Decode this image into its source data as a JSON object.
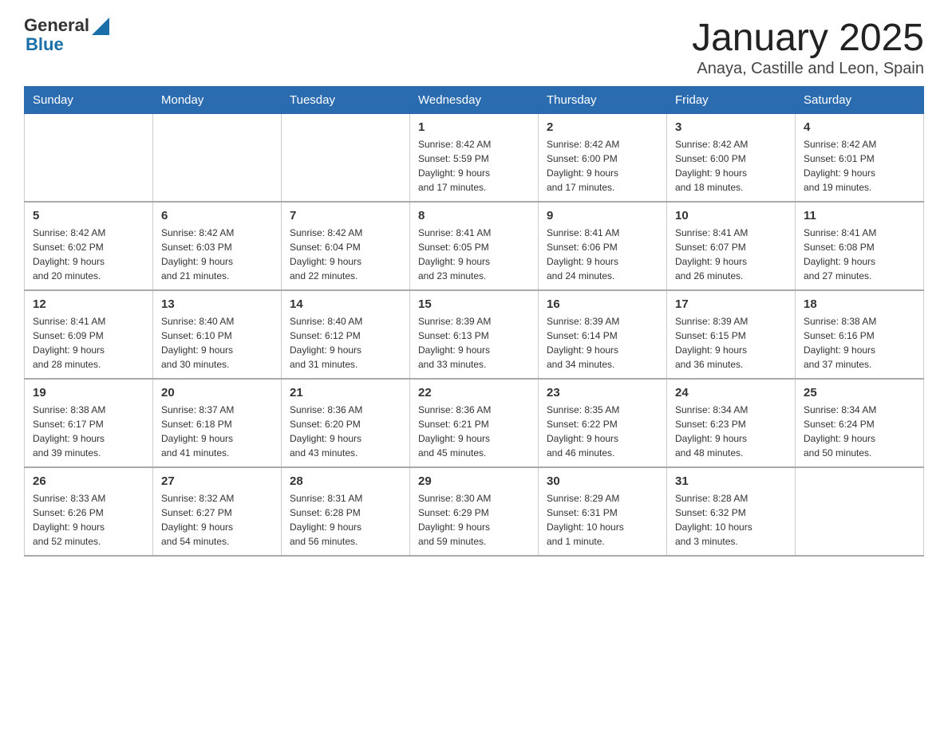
{
  "logo": {
    "text_general": "General",
    "text_blue": "Blue"
  },
  "header": {
    "title": "January 2025",
    "subtitle": "Anaya, Castille and Leon, Spain"
  },
  "weekdays": [
    "Sunday",
    "Monday",
    "Tuesday",
    "Wednesday",
    "Thursday",
    "Friday",
    "Saturday"
  ],
  "weeks": [
    [
      {
        "day": "",
        "info": ""
      },
      {
        "day": "",
        "info": ""
      },
      {
        "day": "",
        "info": ""
      },
      {
        "day": "1",
        "info": "Sunrise: 8:42 AM\nSunset: 5:59 PM\nDaylight: 9 hours\nand 17 minutes."
      },
      {
        "day": "2",
        "info": "Sunrise: 8:42 AM\nSunset: 6:00 PM\nDaylight: 9 hours\nand 17 minutes."
      },
      {
        "day": "3",
        "info": "Sunrise: 8:42 AM\nSunset: 6:00 PM\nDaylight: 9 hours\nand 18 minutes."
      },
      {
        "day": "4",
        "info": "Sunrise: 8:42 AM\nSunset: 6:01 PM\nDaylight: 9 hours\nand 19 minutes."
      }
    ],
    [
      {
        "day": "5",
        "info": "Sunrise: 8:42 AM\nSunset: 6:02 PM\nDaylight: 9 hours\nand 20 minutes."
      },
      {
        "day": "6",
        "info": "Sunrise: 8:42 AM\nSunset: 6:03 PM\nDaylight: 9 hours\nand 21 minutes."
      },
      {
        "day": "7",
        "info": "Sunrise: 8:42 AM\nSunset: 6:04 PM\nDaylight: 9 hours\nand 22 minutes."
      },
      {
        "day": "8",
        "info": "Sunrise: 8:41 AM\nSunset: 6:05 PM\nDaylight: 9 hours\nand 23 minutes."
      },
      {
        "day": "9",
        "info": "Sunrise: 8:41 AM\nSunset: 6:06 PM\nDaylight: 9 hours\nand 24 minutes."
      },
      {
        "day": "10",
        "info": "Sunrise: 8:41 AM\nSunset: 6:07 PM\nDaylight: 9 hours\nand 26 minutes."
      },
      {
        "day": "11",
        "info": "Sunrise: 8:41 AM\nSunset: 6:08 PM\nDaylight: 9 hours\nand 27 minutes."
      }
    ],
    [
      {
        "day": "12",
        "info": "Sunrise: 8:41 AM\nSunset: 6:09 PM\nDaylight: 9 hours\nand 28 minutes."
      },
      {
        "day": "13",
        "info": "Sunrise: 8:40 AM\nSunset: 6:10 PM\nDaylight: 9 hours\nand 30 minutes."
      },
      {
        "day": "14",
        "info": "Sunrise: 8:40 AM\nSunset: 6:12 PM\nDaylight: 9 hours\nand 31 minutes."
      },
      {
        "day": "15",
        "info": "Sunrise: 8:39 AM\nSunset: 6:13 PM\nDaylight: 9 hours\nand 33 minutes."
      },
      {
        "day": "16",
        "info": "Sunrise: 8:39 AM\nSunset: 6:14 PM\nDaylight: 9 hours\nand 34 minutes."
      },
      {
        "day": "17",
        "info": "Sunrise: 8:39 AM\nSunset: 6:15 PM\nDaylight: 9 hours\nand 36 minutes."
      },
      {
        "day": "18",
        "info": "Sunrise: 8:38 AM\nSunset: 6:16 PM\nDaylight: 9 hours\nand 37 minutes."
      }
    ],
    [
      {
        "day": "19",
        "info": "Sunrise: 8:38 AM\nSunset: 6:17 PM\nDaylight: 9 hours\nand 39 minutes."
      },
      {
        "day": "20",
        "info": "Sunrise: 8:37 AM\nSunset: 6:18 PM\nDaylight: 9 hours\nand 41 minutes."
      },
      {
        "day": "21",
        "info": "Sunrise: 8:36 AM\nSunset: 6:20 PM\nDaylight: 9 hours\nand 43 minutes."
      },
      {
        "day": "22",
        "info": "Sunrise: 8:36 AM\nSunset: 6:21 PM\nDaylight: 9 hours\nand 45 minutes."
      },
      {
        "day": "23",
        "info": "Sunrise: 8:35 AM\nSunset: 6:22 PM\nDaylight: 9 hours\nand 46 minutes."
      },
      {
        "day": "24",
        "info": "Sunrise: 8:34 AM\nSunset: 6:23 PM\nDaylight: 9 hours\nand 48 minutes."
      },
      {
        "day": "25",
        "info": "Sunrise: 8:34 AM\nSunset: 6:24 PM\nDaylight: 9 hours\nand 50 minutes."
      }
    ],
    [
      {
        "day": "26",
        "info": "Sunrise: 8:33 AM\nSunset: 6:26 PM\nDaylight: 9 hours\nand 52 minutes."
      },
      {
        "day": "27",
        "info": "Sunrise: 8:32 AM\nSunset: 6:27 PM\nDaylight: 9 hours\nand 54 minutes."
      },
      {
        "day": "28",
        "info": "Sunrise: 8:31 AM\nSunset: 6:28 PM\nDaylight: 9 hours\nand 56 minutes."
      },
      {
        "day": "29",
        "info": "Sunrise: 8:30 AM\nSunset: 6:29 PM\nDaylight: 9 hours\nand 59 minutes."
      },
      {
        "day": "30",
        "info": "Sunrise: 8:29 AM\nSunset: 6:31 PM\nDaylight: 10 hours\nand 1 minute."
      },
      {
        "day": "31",
        "info": "Sunrise: 8:28 AM\nSunset: 6:32 PM\nDaylight: 10 hours\nand 3 minutes."
      },
      {
        "day": "",
        "info": ""
      }
    ]
  ]
}
